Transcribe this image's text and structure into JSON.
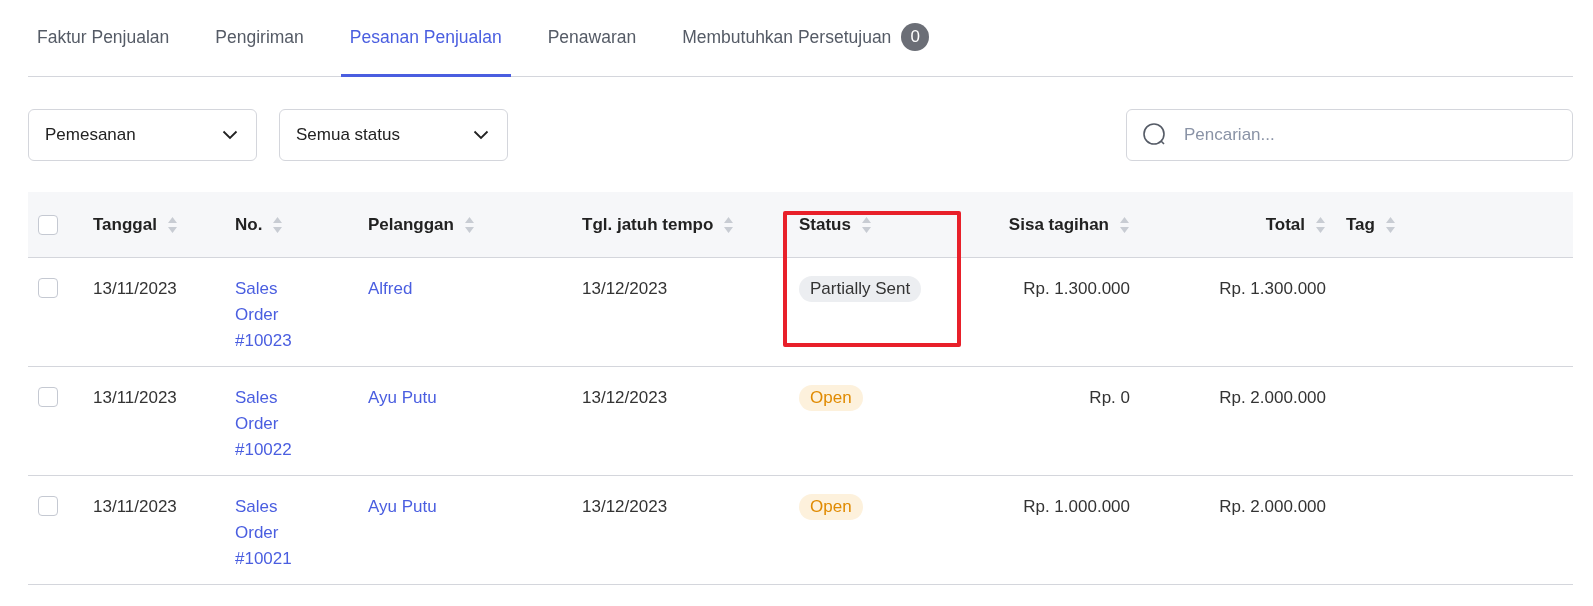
{
  "tabs": [
    {
      "label": "Faktur Penjualan",
      "selected": false
    },
    {
      "label": "Pengiriman",
      "selected": false
    },
    {
      "label": "Pesanan Penjualan",
      "selected": true
    },
    {
      "label": "Penawaran",
      "selected": false
    },
    {
      "label": "Membutuhkan Persetujuan",
      "selected": false,
      "count": "0"
    }
  ],
  "filters": [
    {
      "value": "Pemesanan"
    },
    {
      "value": "Semua status"
    }
  ],
  "search": {
    "placeholder": "Pencarian..."
  },
  "table": {
    "select_all": {
      "checked": false
    },
    "columns": [
      {
        "label": "Tanggal",
        "highlighted": false
      },
      {
        "label": "No.",
        "highlighted": false
      },
      {
        "label": "Pelanggan",
        "highlighted": false
      },
      {
        "label": "Tgl. jatuh tempo",
        "highlighted": false
      },
      {
        "label": "Status",
        "highlighted": true
      },
      {
        "label": "Sisa tagihan",
        "highlighted": false
      },
      {
        "label": "Total",
        "highlighted": false
      },
      {
        "label": "Tag",
        "highlighted": false
      }
    ],
    "rows": [
      {
        "checked": false,
        "date": "13/11/2023",
        "number": "Sales Order #10023",
        "customer": "Alfred",
        "due": "13/12/2023",
        "status": {
          "label": "Partially Sent",
          "kind": "partial"
        },
        "remaining": "Rp. 1.300.000",
        "total": "Rp. 1.300.000"
      },
      {
        "checked": false,
        "date": "13/11/2023",
        "number": "Sales Order #10022",
        "customer": "Ayu Putu",
        "due": "13/12/2023",
        "status": {
          "label": "Open",
          "kind": "open"
        },
        "remaining": "Rp. 0",
        "total": "Rp. 2.000.000"
      },
      {
        "checked": false,
        "date": "13/11/2023",
        "number": "Sales Order #10021",
        "customer": "Ayu Putu",
        "due": "13/12/2023",
        "status": {
          "label": "Open",
          "kind": "open"
        },
        "remaining": "Rp. 1.000.000",
        "total": "Rp. 2.000.000"
      }
    ]
  }
}
